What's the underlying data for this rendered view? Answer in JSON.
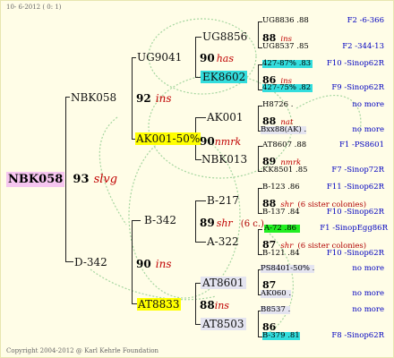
{
  "header_date": "10- 6-2012 ( 0: 1)",
  "footer": "Copyright 2004-2012 @ Karl Kehrle Foundation",
  "colors": {
    "background": "#fffde7",
    "root_highlight": "#f6c6f0",
    "yellow_highlight": "#ffff00",
    "cyan_highlight": "#33dddd",
    "green_highlight": "#22ee22",
    "grey_highlight": "#e4e4f0",
    "italic_red": "#c00000",
    "link_blue": "#0000c0"
  },
  "root": {
    "name": "NBK058",
    "year": "93",
    "breed": "slvg"
  },
  "gen1": [
    {
      "name": "NBK058",
      "year": "92",
      "breed": "ins"
    },
    {
      "name": "D-342",
      "year": "90",
      "breed": "ins"
    }
  ],
  "gen2": [
    {
      "name": "UG9041",
      "year": "90",
      "breed": "has"
    },
    {
      "name": "AK001-50%",
      "year": "90",
      "breed": "nmrk"
    },
    {
      "name": "B-342",
      "year": "89",
      "breed": "shr",
      "extra": "(6 c.)"
    },
    {
      "name": "AT8833",
      "year": "88",
      "breed": "ins"
    }
  ],
  "gen3": [
    {
      "name": "UG8856"
    },
    {
      "name": "EK8602"
    },
    {
      "name": "AK001"
    },
    {
      "name": "NBK013"
    },
    {
      "name": "B-217"
    },
    {
      "name": "A-322"
    },
    {
      "name": "AT8601"
    },
    {
      "name": "AT8503"
    }
  ],
  "gen4": [
    {
      "top": "UG8836 .88",
      "top_link": "F2 -6-366",
      "year": "88",
      "breed": "ins",
      "bot": "UG8537 .85",
      "bot_link": "F2 -344-13"
    },
    {
      "top": "427-87% .83",
      "top_link": "F10 -Sinop62R",
      "year": "86",
      "breed": "ins",
      "bot": "427-75% .82",
      "bot_link": "F9 -Sinop62R"
    },
    {
      "top": "H8726 .",
      "top_link": "no more",
      "year": "88",
      "breed": "nat",
      "bot": "Bxx88(AK) .",
      "bot_link": "no more"
    },
    {
      "top": "AT8607 .88",
      "top_link": "F1 -PS8601",
      "year": "89",
      "breed": "nmrk",
      "bot": "KK8501 .85",
      "bot_link": "F7 -Sinop72R"
    },
    {
      "top": "B-123 .86",
      "top_link": "F11 -Sinop62R",
      "year": "88",
      "breed": "shr",
      "extra": "(6 sister colonies)",
      "bot": "B-137 .84",
      "bot_link": "F10 -Sinop62R"
    },
    {
      "top": "A-72 .86",
      "top_link": "F1 -SinopEgg86R",
      "year": "87",
      "breed": "shr",
      "extra": "(6 sister colonies)",
      "bot": "B-121 .84",
      "bot_link": "F10 -Sinop62R"
    },
    {
      "top": "PS8401-50% .",
      "top_link": "no more",
      "year": "87",
      "breed": "",
      "bot": "AK060 .",
      "bot_link": "no more"
    },
    {
      "top": "B8537 .",
      "top_link": "no more",
      "year": "86",
      "breed": "",
      "bot": "B-379 .81",
      "bot_link": "F8 -Sinop62R"
    }
  ]
}
